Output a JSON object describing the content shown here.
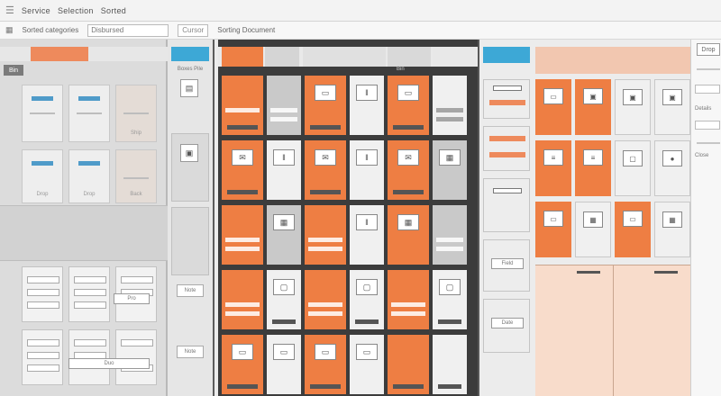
{
  "window": {
    "menu_items": [
      "Service",
      "Selection",
      "Sorted"
    ],
    "toolbar": {
      "crumb": "Sorted categories",
      "search_value": "Disbursed",
      "pill_label": "Cursor",
      "path_text": "Sorting Document"
    }
  },
  "left_panel": {
    "tag": "Bin",
    "cards": [
      {
        "label": ""
      },
      {
        "label": ""
      },
      {
        "label": "Ship"
      },
      {
        "label": "Drop"
      },
      {
        "label": "Drop"
      },
      {
        "label": "Back"
      }
    ],
    "lower_pills": [
      "Pro",
      "Duo"
    ]
  },
  "narrow_panel": {
    "label": "Boxes Pile",
    "small_labels": [
      "Note",
      "Note"
    ]
  },
  "main_grid": {
    "header_text": "Bin"
  },
  "right_grid": {
    "cell_labels": [
      "",
      "",
      "",
      "",
      "",
      "",
      "",
      "",
      "",
      "",
      "",
      ""
    ],
    "pill_labels": [
      "Field",
      "Date"
    ]
  },
  "far_right": {
    "button_label": "Drop",
    "text_rows": [
      "Details",
      "Close"
    ]
  },
  "colors": {
    "accent_orange": "#ee7e43",
    "accent_blue": "#3da8d6",
    "peach": "#f8dccb"
  }
}
